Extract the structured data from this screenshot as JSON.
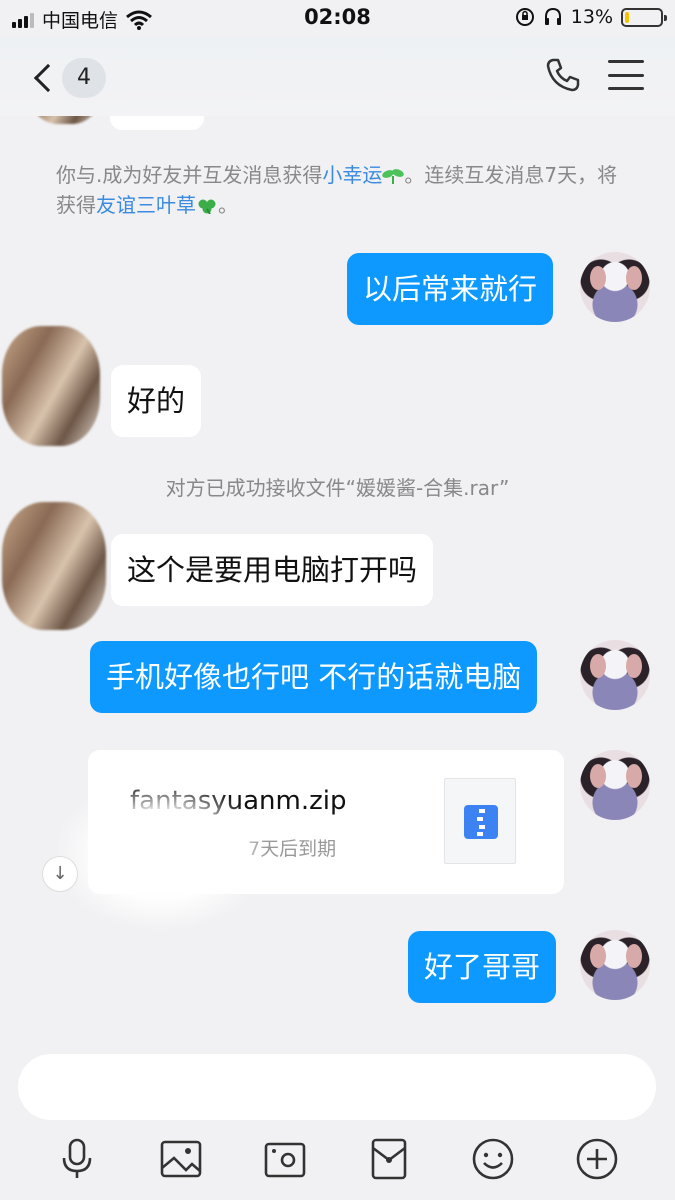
{
  "status_bar": {
    "carrier": "中国电信",
    "time": "02:08",
    "battery": "13%",
    "battery_level": 0.13
  },
  "nav": {
    "unread_count": "4"
  },
  "messages": {
    "system_notice": {
      "part1": "你与.成为好友并互发消息获得",
      "highlight1": "小幸运",
      "part2": "。连续互发消息7天，将获得",
      "highlight2": "友谊三叶草",
      "part3": "。"
    },
    "sent_1": "以后常来就行",
    "recv_1": "好的",
    "file_notice": "对方已成功接收文件“媛媛酱-合集.rar”",
    "recv_2": "这个是要用电脑打开吗",
    "sent_2": "手机好像也行吧 不行的话就电脑",
    "file": {
      "name": "fantasyuanm.zip",
      "expiry": "7天后到期"
    },
    "sent_3": "好了哥哥"
  },
  "input": {
    "placeholder": ""
  },
  "colors": {
    "sent_bubble": "#0d99ff",
    "highlight": "#3a8be0"
  }
}
